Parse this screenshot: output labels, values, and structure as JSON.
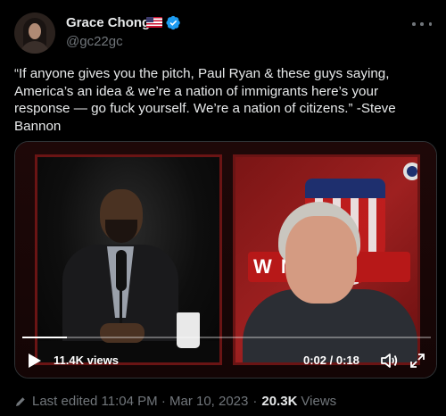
{
  "author": {
    "name": "Grace Chong",
    "handle": "@gc22gc",
    "flag_icon": "us-flag-icon",
    "verified_icon": "verified-badge-icon",
    "verified_color": "#1d9bf0"
  },
  "tweet": {
    "text": "“If anyone gives you the pitch, Paul Ryan & these guys saying, America’s an idea & we’re a nation of immigrants here’s your response — go fuck yourself. We’re a nation of citizens.” -Steve Bannon"
  },
  "video": {
    "views": "11.4K views",
    "time": "0:02 / 0:18",
    "progress": 0.11,
    "banner_text": "W   M",
    "play_icon": "play-icon",
    "volume_icon": "volume-icon",
    "fullscreen_icon": "fullscreen-icon"
  },
  "footer": {
    "edited": "Last edited 11:04 PM · Mar 10, 2023",
    "separator": "·",
    "view_count": "20.3K",
    "views_label": "Views",
    "pencil_icon": "pencil-icon"
  },
  "colors": {
    "background": "#000000",
    "text": "#e7e9ea",
    "secondary": "#71767b",
    "accent": "#1d9bf0"
  }
}
